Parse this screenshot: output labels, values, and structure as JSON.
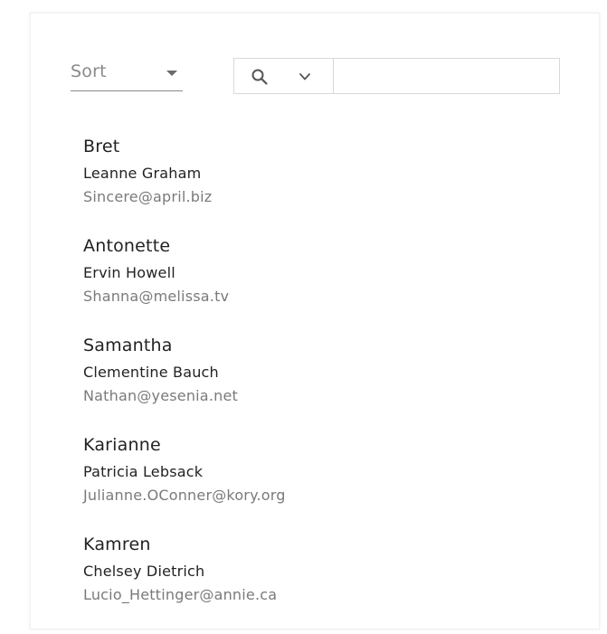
{
  "toolbar": {
    "sort_label": "Sort",
    "search_value": "",
    "search_placeholder": ""
  },
  "icons": {
    "sort_dropdown": "caret-down-icon",
    "search": "search-icon",
    "search_dropdown": "chevron-down-icon"
  },
  "colors": {
    "muted_text": "#7a7a7a",
    "primary_text": "#222222",
    "border": "#d9d9d9"
  },
  "users": [
    {
      "username": "Bret",
      "name": "Leanne Graham",
      "email": "Sincere@april.biz"
    },
    {
      "username": "Antonette",
      "name": "Ervin Howell",
      "email": "Shanna@melissa.tv"
    },
    {
      "username": "Samantha",
      "name": "Clementine Bauch",
      "email": "Nathan@yesenia.net"
    },
    {
      "username": "Karianne",
      "name": "Patricia Lebsack",
      "email": "Julianne.OConner@kory.org"
    },
    {
      "username": "Kamren",
      "name": "Chelsey Dietrich",
      "email": "Lucio_Hettinger@annie.ca"
    }
  ]
}
